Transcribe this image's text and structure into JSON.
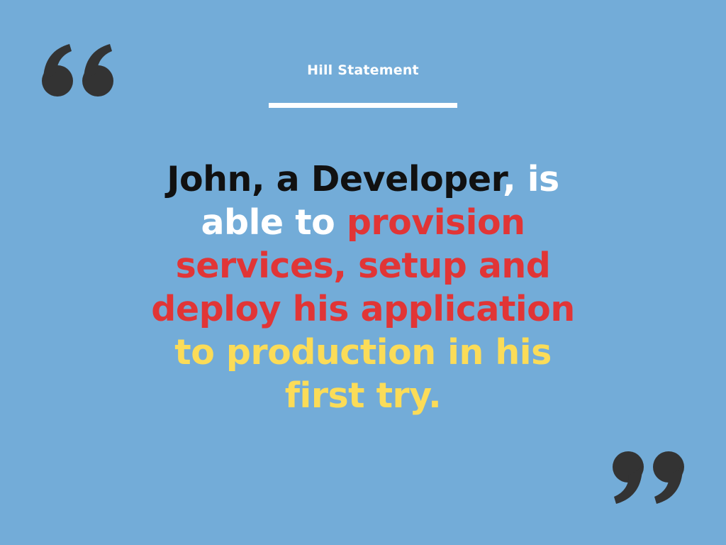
{
  "header": {
    "title": "Hill Statement"
  },
  "statement": {
    "lines": [
      [
        {
          "text": "John, a Developer",
          "tone": "dark"
        },
        {
          "text": ", is",
          "tone": "white"
        }
      ],
      [
        {
          "text": "able to ",
          "tone": "white"
        },
        {
          "text": "provision",
          "tone": "red"
        }
      ],
      [
        {
          "text": "services, setup and",
          "tone": "red"
        }
      ],
      [
        {
          "text": "deploy his application",
          "tone": "red"
        }
      ],
      [
        {
          "text": "to production in his",
          "tone": "yellow"
        }
      ],
      [
        {
          "text": "first try.",
          "tone": "yellow"
        }
      ]
    ]
  },
  "colors": {
    "background": "#73acd8",
    "quote_marks": "#333333",
    "title": "#ffffff",
    "dark": "#111111",
    "white": "#ffffff",
    "red": "#e13536",
    "yellow": "#fbdc58"
  },
  "icons": {
    "open_quote": "open-quote-icon",
    "close_quote": "close-quote-icon"
  }
}
